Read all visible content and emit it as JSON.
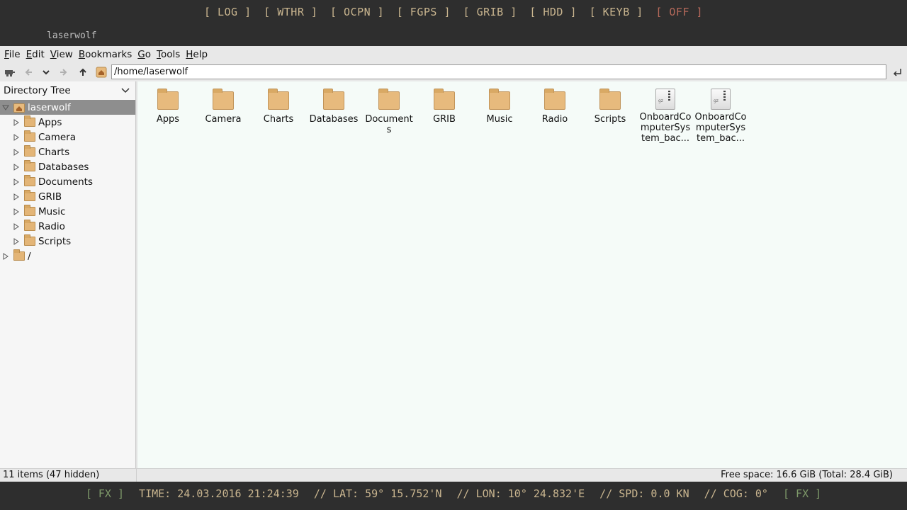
{
  "top_panel": {
    "buttons": [
      "[ LOG ]",
      "[ WTHR ]",
      "[ OCPN ]",
      "[ FGPS ]",
      "[ GRIB ]",
      "[ HDD ]",
      "[ KEYB ]",
      "[ OFF ]"
    ],
    "window_title": "laserwolf",
    "colors": {
      "text": "#c9b58f",
      "off": "#b5695a",
      "background": "#2e2e2e"
    }
  },
  "menubar": {
    "items": [
      {
        "mnemonic": "F",
        "rest": "ile"
      },
      {
        "mnemonic": "E",
        "rest": "dit"
      },
      {
        "mnemonic": "V",
        "rest": "iew"
      },
      {
        "mnemonic": "B",
        "rest": "ookmarks"
      },
      {
        "mnemonic": "G",
        "rest": "o"
      },
      {
        "mnemonic": "T",
        "rest": "ools"
      },
      {
        "mnemonic": "H",
        "rest": "elp"
      }
    ]
  },
  "toolbar": {
    "path": "/home/laserwolf",
    "icons": [
      "new-window-icon",
      "back-icon",
      "history-down-icon",
      "forward-icon",
      "up-icon",
      "home-icon",
      "go-icon"
    ]
  },
  "sidebar": {
    "header": "Directory Tree",
    "root": "laserwolf",
    "items": [
      "Apps",
      "Camera",
      "Charts",
      "Databases",
      "Documents",
      "GRIB",
      "Music",
      "Radio",
      "Scripts"
    ],
    "filesystem_root": "/"
  },
  "main": {
    "items": [
      {
        "label": "Apps",
        "kind": "folder"
      },
      {
        "label": "Camera",
        "kind": "folder"
      },
      {
        "label": "Charts",
        "kind": "folder"
      },
      {
        "label": "Databases",
        "kind": "folder"
      },
      {
        "label": "Documents",
        "kind": "folder"
      },
      {
        "label": "GRIB",
        "kind": "folder"
      },
      {
        "label": "Music",
        "kind": "folder"
      },
      {
        "label": "Radio",
        "kind": "folder"
      },
      {
        "label": "Scripts",
        "kind": "folder"
      },
      {
        "label": "OnboardComputerSystem_bac...",
        "kind": "archive"
      },
      {
        "label": "OnboardComputerSystem_bac...",
        "kind": "archive"
      }
    ],
    "archive_badge": "gz"
  },
  "statusbar": {
    "left": "11 items (47 hidden)",
    "right": "Free space: 16.6 GiB (Total: 28.4 GiB)"
  },
  "bottom_panel": {
    "fx": "[ FX ]",
    "time": "TIME: 24.03.2016 21:24:39",
    "lat": "// LAT: 59° 15.752'N",
    "lon": "// LON: 10° 24.832'E",
    "spd": "// SPD: 0.0 KN",
    "cog": "// COG: 0°"
  }
}
